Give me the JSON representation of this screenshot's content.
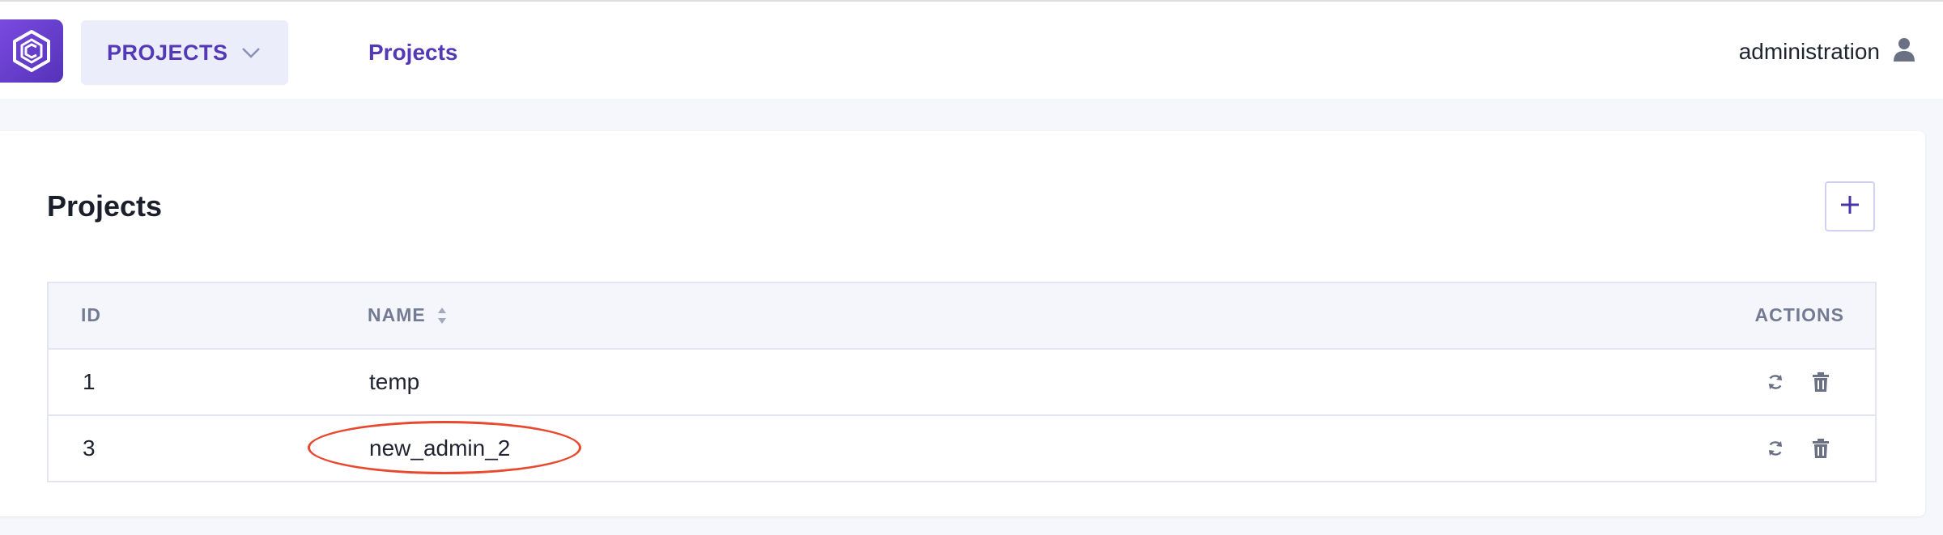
{
  "header": {
    "logo_icon": "cvat-logo-icon",
    "project_switch_label": "PROJECTS",
    "nav_link": "Projects",
    "user_name": "administration",
    "user_icon": "user-icon",
    "accent_color": "#5339b6"
  },
  "main": {
    "title": "Projects",
    "add_button_icon": "plus-icon"
  },
  "table": {
    "columns": [
      "ID",
      "NAME",
      "ACTIONS"
    ],
    "rows": [
      {
        "id": "1",
        "name": "temp"
      },
      {
        "id": "3",
        "name": "new_admin_2"
      }
    ],
    "action_icons": [
      "refresh-icon",
      "trash-icon"
    ]
  },
  "annotation": {
    "highlight_color": "#e8482e",
    "highlighted_row_name": "new_admin_2"
  }
}
